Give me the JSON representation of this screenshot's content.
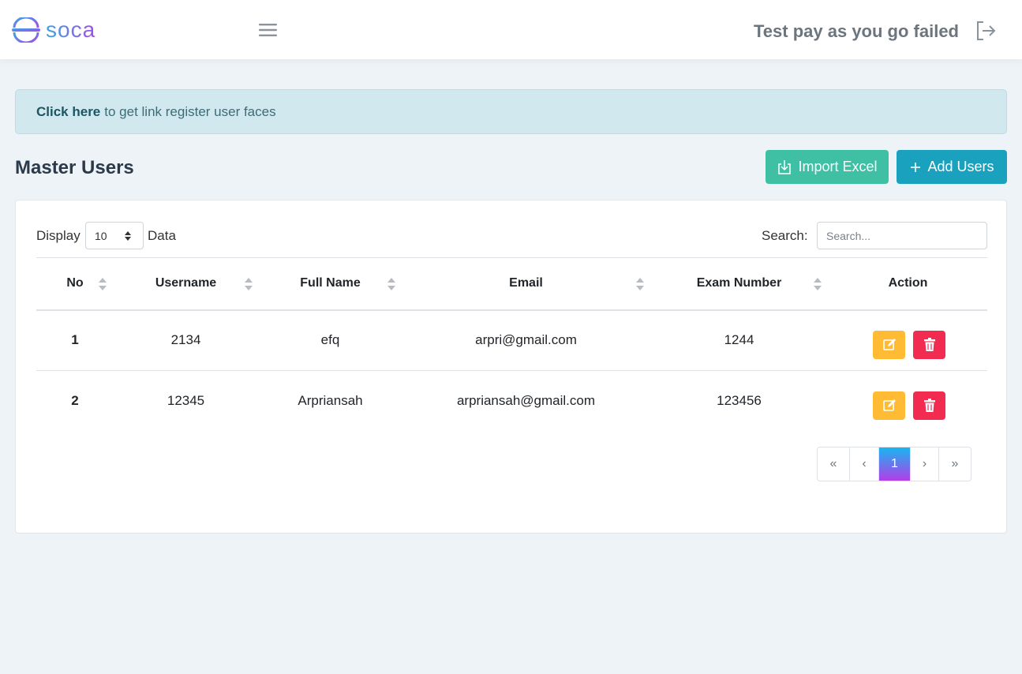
{
  "header": {
    "logo_text": "SOCA",
    "title": "Test pay as you go failed",
    "icons": [
      "logo-icon",
      "hamburger-icon",
      "logout-icon"
    ]
  },
  "alert": {
    "link_text": "Click here",
    "message": "to get link register user faces"
  },
  "page": {
    "title": "Master Users",
    "import_label": "Import Excel",
    "add_label": "Add Users"
  },
  "table_controls": {
    "display_label": "Display",
    "display_value": "10",
    "data_label": "Data",
    "search_label": "Search:",
    "search_placeholder": "Search..."
  },
  "table": {
    "columns": [
      "No",
      "Username",
      "Full Name",
      "Email",
      "Exam Number",
      "Action"
    ],
    "rows": [
      {
        "no": "1",
        "username": "2134",
        "full_name": "efq",
        "email": "arpri@gmail.com",
        "exam_number": "1244"
      },
      {
        "no": "2",
        "username": "12345",
        "full_name": "Arpriansah",
        "email": "arpriansah@gmail.com",
        "exam_number": "123456"
      }
    ]
  },
  "pagination": {
    "first": "«",
    "prev": "‹",
    "current": "1",
    "next": "›",
    "last": "»"
  },
  "colors": {
    "import_button": "#3fbfa4",
    "add_button": "#1aa1bd",
    "edit_button": "#ffbb33",
    "delete_button": "#f22b51",
    "alert_bg": "#d1e8ee"
  }
}
